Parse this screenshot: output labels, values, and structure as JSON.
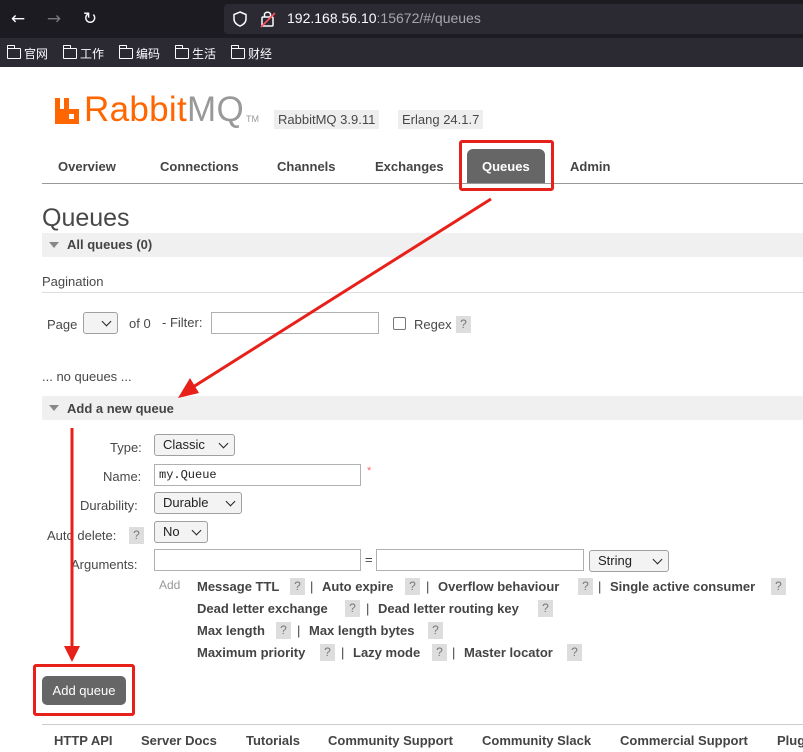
{
  "browser": {
    "url_host": "192.168.56.10",
    "url_rest": ":15672/#/queues",
    "bookmarks": [
      "官网",
      "工作",
      "编码",
      "生活",
      "财经"
    ]
  },
  "app": {
    "logo_rabbit": "Rabbit",
    "logo_mq": "MQ",
    "logo_tm": "TM",
    "version": "RabbitMQ 3.9.11",
    "erlang": "Erlang 24.1.7"
  },
  "tabs": [
    "Overview",
    "Connections",
    "Channels",
    "Exchanges",
    "Queues",
    "Admin"
  ],
  "active_tab": "Queues",
  "page": {
    "title": "Queues",
    "all_queues": "All queues (0)",
    "pagination_label": "Pagination",
    "page_label": "Page",
    "of_label": "of 0",
    "filter_label": "- Filter:",
    "regex_label": "Regex",
    "empty_text": "... no queues ..."
  },
  "add_queue": {
    "section_title": "Add a new queue",
    "type_label": "Type:",
    "type_value": "Classic",
    "name_label": "Name:",
    "name_value": "my.Queue",
    "required_mark": "*",
    "durability_label": "Durability:",
    "durability_value": "Durable",
    "auto_delete_label": "Auto delete:",
    "auto_delete_value": "No",
    "arguments_label": "Arguments:",
    "equals": "=",
    "arg_type_value": "String",
    "add_link": "Add",
    "argument_keys": [
      "Message TTL",
      "Auto expire",
      "Overflow behaviour",
      "Single active consumer",
      "Dead letter exchange",
      "Dead letter routing key",
      "Max length",
      "Max length bytes",
      "Maximum priority",
      "Lazy mode",
      "Master locator"
    ],
    "help": "?",
    "separator": "|",
    "button_label": "Add queue"
  },
  "footer": [
    "HTTP API",
    "Server Docs",
    "Tutorials",
    "Community Support",
    "Community Slack",
    "Commercial Support",
    "Plug"
  ],
  "colors": {
    "accent": "#ff6600",
    "annotation": "#e8201a",
    "tab_active": "#666666"
  }
}
